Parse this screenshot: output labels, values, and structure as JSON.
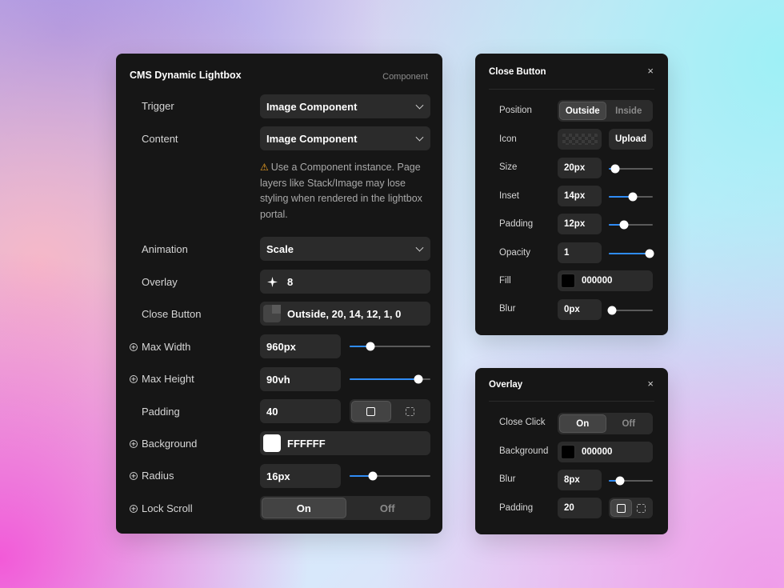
{
  "main": {
    "title": "CMS Dynamic Lightbox",
    "tag": "Component",
    "trigger_label": "Trigger",
    "trigger_value": "Image Component",
    "content_label": "Content",
    "content_value": "Image Component",
    "warning_icon": "⚠",
    "warning_text": "Use a Component instance. Page layers like Stack/Image may lose styling when rendered in the lightbox portal.",
    "animation_label": "Animation",
    "animation_value": "Scale",
    "overlay_label": "Overlay",
    "overlay_value": "8",
    "close_button_label": "Close Button",
    "close_button_value": "Outside, 20, 14, 12, 1, 0",
    "max_width_label": "Max Width",
    "max_width_value": "960px",
    "max_width_slider": 0.26,
    "max_height_label": "Max Height",
    "max_height_value": "90vh",
    "max_height_slider": 0.85,
    "padding_label": "Padding",
    "padding_value": "40",
    "background_label": "Background",
    "background_value": "FFFFFF",
    "background_color": "#FFFFFF",
    "radius_label": "Radius",
    "radius_value": "16px",
    "radius_slider": 0.29,
    "lock_scroll_label": "Lock Scroll",
    "lock_scroll_on": "On",
    "lock_scroll_off": "Off"
  },
  "close_button_panel": {
    "title": "Close Button",
    "close_glyph": "×",
    "position_label": "Position",
    "position_outside": "Outside",
    "position_inside": "Inside",
    "icon_label": "Icon",
    "upload_label": "Upload",
    "size_label": "Size",
    "size_value": "20px",
    "size_slider": 0.15,
    "inset_label": "Inset",
    "inset_value": "14px",
    "inset_slider": 0.55,
    "padding_label": "Padding",
    "padding_value": "12px",
    "padding_slider": 0.35,
    "opacity_label": "Opacity",
    "opacity_value": "1",
    "opacity_slider": 1.0,
    "fill_label": "Fill",
    "fill_value": "000000",
    "blur_label": "Blur",
    "blur_value": "0px",
    "blur_slider": 0.0
  },
  "overlay_panel": {
    "title": "Overlay",
    "close_glyph": "×",
    "close_click_label": "Close Click",
    "close_click_on": "On",
    "close_click_off": "Off",
    "background_label": "Background",
    "background_value": "000000",
    "blur_label": "Blur",
    "blur_value": "8px",
    "blur_slider": 0.25,
    "padding_label": "Padding",
    "padding_value": "20"
  },
  "colors": {
    "accent": "#2F8CF5",
    "panel": "#161616",
    "field": "#2B2B2B"
  }
}
